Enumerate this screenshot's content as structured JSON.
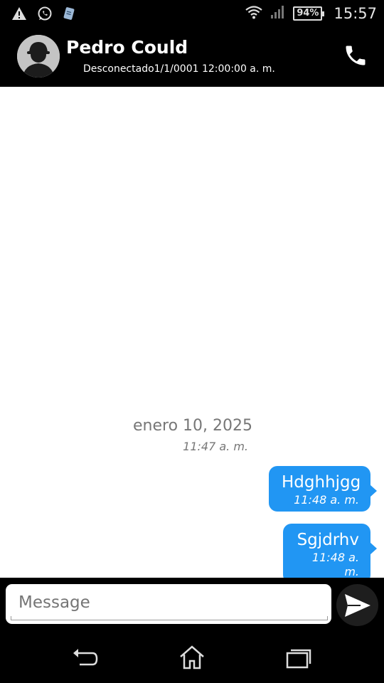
{
  "status_bar": {
    "icons_left": [
      "warning-icon",
      "whatsapp-icon",
      "notes-icon"
    ],
    "icons_right": [
      "wifi-icon",
      "signal-icon"
    ],
    "battery": "94%",
    "time": "15:57"
  },
  "header": {
    "contact_name": "Pedro Could",
    "contact_status": "Desconectado1/1/0001 12:00:00 a. m.",
    "call_icon": "phone-icon"
  },
  "chat": {
    "date": "enero 10, 2025",
    "date_time": "11:47 a. m.",
    "messages": [
      {
        "text": "Hdghhjgg",
        "time": "11:48 a. m.",
        "direction": "outgoing"
      },
      {
        "text": "Sgjdrhv",
        "time": "11:48 a. m.",
        "direction": "outgoing"
      }
    ]
  },
  "composer": {
    "placeholder": "Message",
    "send_icon": "send-icon"
  },
  "nav": {
    "icons": [
      "back-icon",
      "home-icon",
      "recents-icon"
    ]
  },
  "colors": {
    "bubble": "#2196f3",
    "bar_background": "#000000",
    "chat_background": "#ffffff"
  }
}
